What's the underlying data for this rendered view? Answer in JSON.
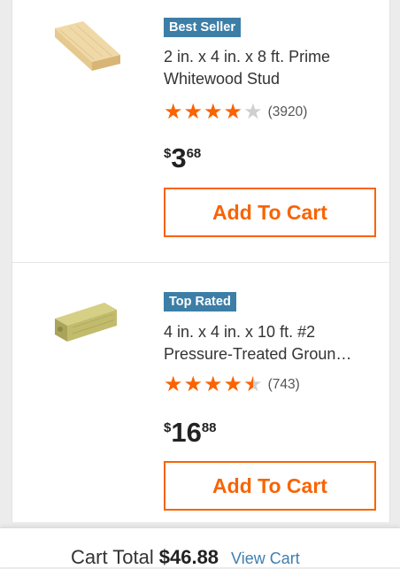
{
  "products": [
    {
      "badge": "Best Seller",
      "title_line1": "2 in. x 4 in. x 8 ft. Prime",
      "title_line2": "Whitewood Stud",
      "rating": 4,
      "rating_max": 5,
      "review_count": "(3920)",
      "price_currency": "$",
      "price_dollars": "3",
      "price_cents": "68",
      "button_label": "Add To Cart",
      "image_icon": "lumber-stud-icon"
    },
    {
      "badge": "Top Rated",
      "title_line1": "4 in. x 4 in. x 10 ft. #2",
      "title_line2": "Pressure-Treated Groun…",
      "rating": 4.5,
      "rating_max": 5,
      "review_count": "(743)",
      "price_currency": "$",
      "price_dollars": "16",
      "price_cents": "88",
      "button_label": "Add To Cart",
      "image_icon": "treated-post-icon"
    }
  ],
  "footer": {
    "cart_total_label": "Cart Total",
    "cart_total_value": "$46.88",
    "view_cart_label": "View Cart"
  },
  "colors": {
    "accent": "#f96302",
    "badge": "#3d7ea6",
    "link": "#3e7fb0",
    "star_empty": "#cfcfcf"
  }
}
